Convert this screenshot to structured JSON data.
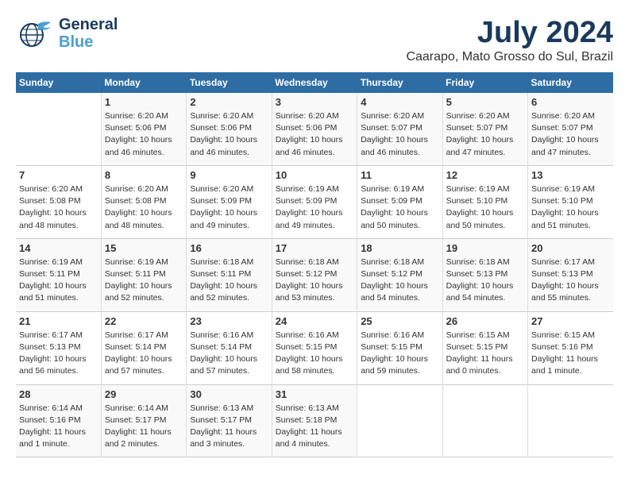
{
  "logo": {
    "line1": "General",
    "line2": "Blue"
  },
  "title": "July 2024",
  "subtitle": "Caarapo, Mato Grosso do Sul, Brazil",
  "weekdays": [
    "Sunday",
    "Monday",
    "Tuesday",
    "Wednesday",
    "Thursday",
    "Friday",
    "Saturday"
  ],
  "weeks": [
    [
      {
        "day": "",
        "info": ""
      },
      {
        "day": "1",
        "info": "Sunrise: 6:20 AM\nSunset: 5:06 PM\nDaylight: 10 hours\nand 46 minutes."
      },
      {
        "day": "2",
        "info": "Sunrise: 6:20 AM\nSunset: 5:06 PM\nDaylight: 10 hours\nand 46 minutes."
      },
      {
        "day": "3",
        "info": "Sunrise: 6:20 AM\nSunset: 5:06 PM\nDaylight: 10 hours\nand 46 minutes."
      },
      {
        "day": "4",
        "info": "Sunrise: 6:20 AM\nSunset: 5:07 PM\nDaylight: 10 hours\nand 46 minutes."
      },
      {
        "day": "5",
        "info": "Sunrise: 6:20 AM\nSunset: 5:07 PM\nDaylight: 10 hours\nand 47 minutes."
      },
      {
        "day": "6",
        "info": "Sunrise: 6:20 AM\nSunset: 5:07 PM\nDaylight: 10 hours\nand 47 minutes."
      }
    ],
    [
      {
        "day": "7",
        "info": "Sunrise: 6:20 AM\nSunset: 5:08 PM\nDaylight: 10 hours\nand 48 minutes."
      },
      {
        "day": "8",
        "info": "Sunrise: 6:20 AM\nSunset: 5:08 PM\nDaylight: 10 hours\nand 48 minutes."
      },
      {
        "day": "9",
        "info": "Sunrise: 6:20 AM\nSunset: 5:09 PM\nDaylight: 10 hours\nand 49 minutes."
      },
      {
        "day": "10",
        "info": "Sunrise: 6:19 AM\nSunset: 5:09 PM\nDaylight: 10 hours\nand 49 minutes."
      },
      {
        "day": "11",
        "info": "Sunrise: 6:19 AM\nSunset: 5:09 PM\nDaylight: 10 hours\nand 50 minutes."
      },
      {
        "day": "12",
        "info": "Sunrise: 6:19 AM\nSunset: 5:10 PM\nDaylight: 10 hours\nand 50 minutes."
      },
      {
        "day": "13",
        "info": "Sunrise: 6:19 AM\nSunset: 5:10 PM\nDaylight: 10 hours\nand 51 minutes."
      }
    ],
    [
      {
        "day": "14",
        "info": "Sunrise: 6:19 AM\nSunset: 5:11 PM\nDaylight: 10 hours\nand 51 minutes."
      },
      {
        "day": "15",
        "info": "Sunrise: 6:19 AM\nSunset: 5:11 PM\nDaylight: 10 hours\nand 52 minutes."
      },
      {
        "day": "16",
        "info": "Sunrise: 6:18 AM\nSunset: 5:11 PM\nDaylight: 10 hours\nand 52 minutes."
      },
      {
        "day": "17",
        "info": "Sunrise: 6:18 AM\nSunset: 5:12 PM\nDaylight: 10 hours\nand 53 minutes."
      },
      {
        "day": "18",
        "info": "Sunrise: 6:18 AM\nSunset: 5:12 PM\nDaylight: 10 hours\nand 54 minutes."
      },
      {
        "day": "19",
        "info": "Sunrise: 6:18 AM\nSunset: 5:13 PM\nDaylight: 10 hours\nand 54 minutes."
      },
      {
        "day": "20",
        "info": "Sunrise: 6:17 AM\nSunset: 5:13 PM\nDaylight: 10 hours\nand 55 minutes."
      }
    ],
    [
      {
        "day": "21",
        "info": "Sunrise: 6:17 AM\nSunset: 5:13 PM\nDaylight: 10 hours\nand 56 minutes."
      },
      {
        "day": "22",
        "info": "Sunrise: 6:17 AM\nSunset: 5:14 PM\nDaylight: 10 hours\nand 57 minutes."
      },
      {
        "day": "23",
        "info": "Sunrise: 6:16 AM\nSunset: 5:14 PM\nDaylight: 10 hours\nand 57 minutes."
      },
      {
        "day": "24",
        "info": "Sunrise: 6:16 AM\nSunset: 5:15 PM\nDaylight: 10 hours\nand 58 minutes."
      },
      {
        "day": "25",
        "info": "Sunrise: 6:16 AM\nSunset: 5:15 PM\nDaylight: 10 hours\nand 59 minutes."
      },
      {
        "day": "26",
        "info": "Sunrise: 6:15 AM\nSunset: 5:15 PM\nDaylight: 11 hours\nand 0 minutes."
      },
      {
        "day": "27",
        "info": "Sunrise: 6:15 AM\nSunset: 5:16 PM\nDaylight: 11 hours\nand 1 minute."
      }
    ],
    [
      {
        "day": "28",
        "info": "Sunrise: 6:14 AM\nSunset: 5:16 PM\nDaylight: 11 hours\nand 1 minute."
      },
      {
        "day": "29",
        "info": "Sunrise: 6:14 AM\nSunset: 5:17 PM\nDaylight: 11 hours\nand 2 minutes."
      },
      {
        "day": "30",
        "info": "Sunrise: 6:13 AM\nSunset: 5:17 PM\nDaylight: 11 hours\nand 3 minutes."
      },
      {
        "day": "31",
        "info": "Sunrise: 6:13 AM\nSunset: 5:18 PM\nDaylight: 11 hours\nand 4 minutes."
      },
      {
        "day": "",
        "info": ""
      },
      {
        "day": "",
        "info": ""
      },
      {
        "day": "",
        "info": ""
      }
    ]
  ]
}
